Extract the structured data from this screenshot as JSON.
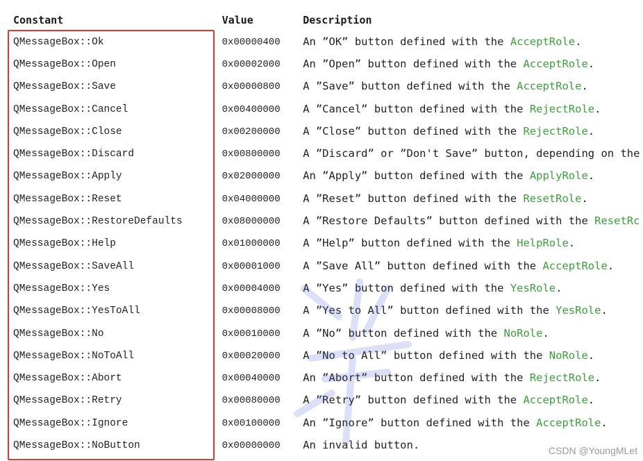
{
  "header": {
    "constant": "Constant",
    "value": "Value",
    "description": "Description"
  },
  "rows": [
    {
      "constant": "QMessageBox::Ok",
      "value": "0x00000400",
      "desc_pre": "An ”OK” button defined with the ",
      "role": "AcceptRole",
      "desc_post": "."
    },
    {
      "constant": "QMessageBox::Open",
      "value": "0x00002000",
      "desc_pre": "An ”Open” button defined with the ",
      "role": "AcceptRole",
      "desc_post": "."
    },
    {
      "constant": "QMessageBox::Save",
      "value": "0x00000800",
      "desc_pre": "A ”Save” button defined with the ",
      "role": "AcceptRole",
      "desc_post": "."
    },
    {
      "constant": "QMessageBox::Cancel",
      "value": "0x00400000",
      "desc_pre": "A ”Cancel” button defined with the ",
      "role": "RejectRole",
      "desc_post": "."
    },
    {
      "constant": "QMessageBox::Close",
      "value": "0x00200000",
      "desc_pre": "A ”Close” button defined with the ",
      "role": "RejectRole",
      "desc_post": "."
    },
    {
      "constant": "QMessageBox::Discard",
      "value": "0x00800000",
      "desc_pre": "A ”Discard” or ”Don't Save” button, depending on the",
      "role": "",
      "desc_post": ""
    },
    {
      "constant": "QMessageBox::Apply",
      "value": "0x02000000",
      "desc_pre": "An ”Apply” button defined with the ",
      "role": "ApplyRole",
      "desc_post": "."
    },
    {
      "constant": "QMessageBox::Reset",
      "value": "0x04000000",
      "desc_pre": "A ”Reset” button defined with the ",
      "role": "ResetRole",
      "desc_post": "."
    },
    {
      "constant": "QMessageBox::RestoreDefaults",
      "value": "0x08000000",
      "desc_pre": "A ”Restore Defaults” button defined with the ",
      "role": "ResetRc",
      "desc_post": ""
    },
    {
      "constant": "QMessageBox::Help",
      "value": "0x01000000",
      "desc_pre": "A ”Help” button defined with the ",
      "role": "HelpRole",
      "desc_post": "."
    },
    {
      "constant": "QMessageBox::SaveAll",
      "value": "0x00001000",
      "desc_pre": "A ”Save All” button defined with the ",
      "role": "AcceptRole",
      "desc_post": "."
    },
    {
      "constant": "QMessageBox::Yes",
      "value": "0x00004000",
      "desc_pre": "A ”Yes” button defined with the ",
      "role": "YesRole",
      "desc_post": "."
    },
    {
      "constant": "QMessageBox::YesToAll",
      "value": "0x00008000",
      "desc_pre": "A ”Yes to All” button defined with the ",
      "role": "YesRole",
      "desc_post": "."
    },
    {
      "constant": "QMessageBox::No",
      "value": "0x00010000",
      "desc_pre": "A ”No” button defined with the ",
      "role": "NoRole",
      "desc_post": "."
    },
    {
      "constant": "QMessageBox::NoToAll",
      "value": "0x00020000",
      "desc_pre": "A ”No to All” button defined with the ",
      "role": "NoRole",
      "desc_post": "."
    },
    {
      "constant": "QMessageBox::Abort",
      "value": "0x00040000",
      "desc_pre": "An ”Abort” button defined with the ",
      "role": "RejectRole",
      "desc_post": "."
    },
    {
      "constant": "QMessageBox::Retry",
      "value": "0x00080000",
      "desc_pre": "A ”Retry” button defined with the ",
      "role": "AcceptRole",
      "desc_post": "."
    },
    {
      "constant": "QMessageBox::Ignore",
      "value": "0x00100000",
      "desc_pre": "An ”Ignore” button defined with the ",
      "role": "AcceptRole",
      "desc_post": "."
    },
    {
      "constant": "QMessageBox::NoButton",
      "value": "0x00000000",
      "desc_pre": "An invalid button.",
      "role": "",
      "desc_post": ""
    }
  ],
  "watermark": "CSDN @YoungMLet",
  "colors": {
    "role_link": "#3aa13a",
    "highlight_border": "#e03a2a",
    "watermark": "#9a9a9a"
  }
}
